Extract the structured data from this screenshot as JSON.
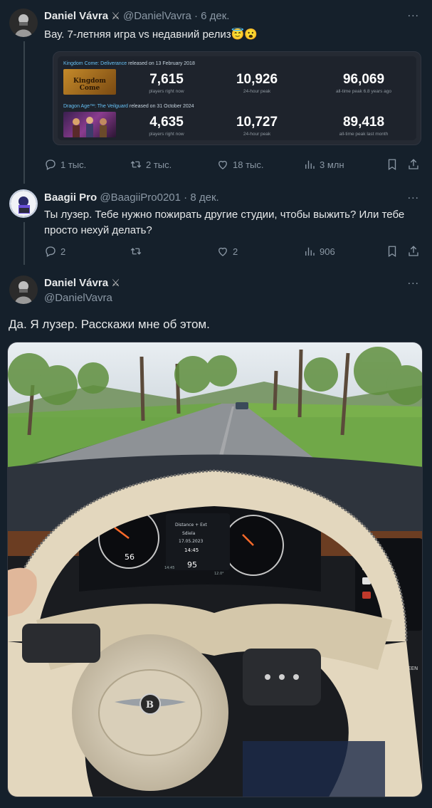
{
  "tweet1": {
    "name": "Daniel Vávra",
    "badge": "⚔",
    "handle": "@DanielVavra",
    "time": "· 6 дек.",
    "text": "Вау. 7-летняя игра vs недавний релиз😇😮",
    "stats": {
      "replies": "1 тыс.",
      "retweets": "2 тыс.",
      "likes": "18 тыс.",
      "views": "3 млн"
    },
    "card": {
      "game1": {
        "name": "Kingdom Come: Deliverance",
        "released": "released on 13 February 2018",
        "thumb_text": "Kingdom Come",
        "players": "7,615",
        "players_label": "players right now",
        "peak24": "10,926",
        "peak24_label": "24-hour peak",
        "alltime": "96,069",
        "alltime_label": "all-time peak 6.8 years ago"
      },
      "game2": {
        "name": "Dragon Age™: The Veilguard",
        "released": "released on 31 October 2024",
        "players": "4,635",
        "players_label": "players right now",
        "peak24": "10,727",
        "peak24_label": "24-hour peak",
        "alltime": "89,418",
        "alltime_label": "all-time peak last month"
      }
    }
  },
  "tweet2": {
    "name": "Baagii Pro",
    "handle": "@BaagiiPro0201",
    "time": "· 8 дек.",
    "text_line1": "Ты лузер. Тебе нужно пожирать другие студии, чтобы выжить? Или тебе",
    "text_line2": "просто нехуй делать?",
    "stats": {
      "replies": "2",
      "retweets": "",
      "likes": "2",
      "views": "906"
    }
  },
  "tweet3": {
    "name": "Daniel Vávra",
    "badge": "⚔",
    "handle": "@DanielVavra",
    "text": "Да. Я лузер. Расскажи мне об этом."
  },
  "dashboard": {
    "speed": "56",
    "temp": "12.0°",
    "center_speed": "95",
    "center_line1": "Distance + Ext",
    "center_line2": "Sdiela",
    "center_date": "17.05.2023",
    "center_time": "14:45",
    "clock_time": "14:45",
    "brand_letter": "B",
    "screen_label": "SCREEN"
  },
  "more_icon": "...",
  "colors": {
    "bg": "#15202b",
    "muted": "#8b98a5",
    "steam_blue": "#66c0f4"
  }
}
